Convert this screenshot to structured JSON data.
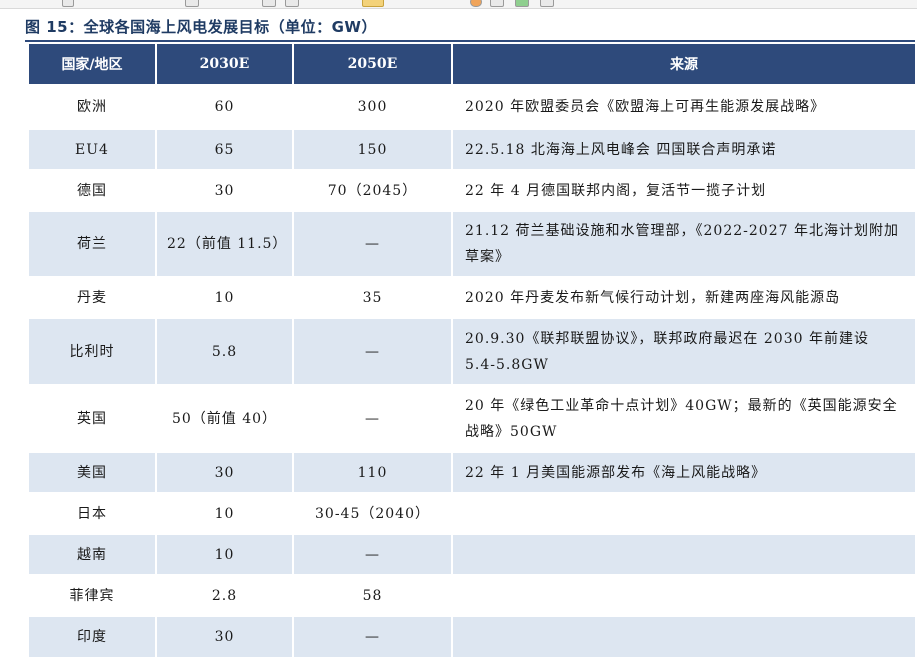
{
  "title": "图 15：全球各国海上风电发展目标（单位：GW）",
  "headers": [
    "国家/地区",
    "2030E",
    "2050E",
    "来源"
  ],
  "rows": [
    {
      "country": "欧洲",
      "y2030": "60",
      "y2050": "300",
      "source": "2020 年欧盟委员会《欧盟海上可再生能源发展战略》"
    },
    {
      "country": "EU4",
      "y2030": "65",
      "y2050": "150",
      "source": "22.5.18 北海海上风电峰会 四国联合声明承诺"
    },
    {
      "country": "德国",
      "y2030": "30",
      "y2050": "70（2045）",
      "source": "22 年 4 月德国联邦内阁，复活节一揽子计划"
    },
    {
      "country": "荷兰",
      "y2030": "22（前值 11.5）",
      "y2050": "—",
      "source": "21.12 荷兰基础设施和水管理部，《2022-2027 年北海计划附加草案》"
    },
    {
      "country": "丹麦",
      "y2030": "10",
      "y2050": "35",
      "source": "2020 年丹麦发布新气候行动计划，新建两座海风能源岛"
    },
    {
      "country": "比利时",
      "y2030": "5.8",
      "y2050": "—",
      "source": "20.9.30《联邦联盟协议》，联邦政府最迟在 2030 年前建设 5.4-5.8GW"
    },
    {
      "country": "英国",
      "y2030": "50（前值 40）",
      "y2050": "—",
      "source": "20 年《绿色工业革命十点计划》40GW；最新的《英国能源安全战略》50GW"
    },
    {
      "country": "美国",
      "y2030": "30",
      "y2050": "110",
      "source": "22 年 1 月美国能源部发布《海上风能战略》"
    },
    {
      "country": "日本",
      "y2030": "10",
      "y2050": "30-45（2040）",
      "source": ""
    },
    {
      "country": "越南",
      "y2030": "10",
      "y2050": "—",
      "source": ""
    },
    {
      "country": "菲律宾",
      "y2030": "2.8",
      "y2050": "58",
      "source": ""
    },
    {
      "country": "印度",
      "y2030": "30",
      "y2050": "—",
      "source": ""
    }
  ]
}
